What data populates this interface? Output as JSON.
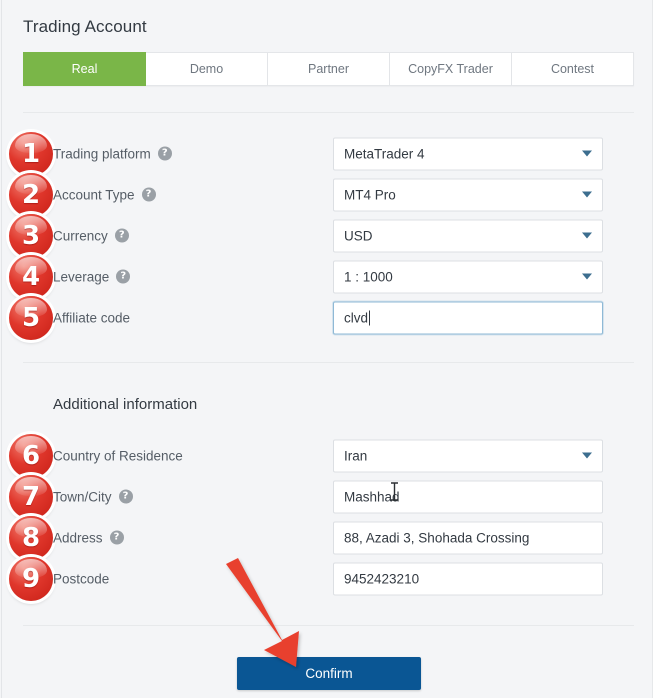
{
  "header": {
    "title": "Trading Account"
  },
  "tabs": [
    {
      "label": "Real",
      "active": true
    },
    {
      "label": "Demo",
      "active": false
    },
    {
      "label": "Partner",
      "active": false
    },
    {
      "label": "CopyFX Trader",
      "active": false
    },
    {
      "label": "Contest",
      "active": false
    }
  ],
  "account_form": {
    "rows": [
      {
        "badge": "1",
        "label": "Trading platform",
        "has_help": true,
        "control_type": "dropdown",
        "value": "MetaTrader 4",
        "focused": false
      },
      {
        "badge": "2",
        "label": "Account Type",
        "has_help": true,
        "control_type": "dropdown",
        "value": "MT4 Pro",
        "focused": false
      },
      {
        "badge": "3",
        "label": "Currency",
        "has_help": true,
        "control_type": "dropdown",
        "value": "USD",
        "focused": false
      },
      {
        "badge": "4",
        "label": "Leverage",
        "has_help": true,
        "control_type": "dropdown",
        "value": "1 : 1000",
        "focused": false
      },
      {
        "badge": "5",
        "label": "Affiliate code",
        "has_help": false,
        "control_type": "text",
        "value": "clvd",
        "focused": true
      }
    ]
  },
  "additional_information": {
    "heading": "Additional information",
    "rows": [
      {
        "badge": "6",
        "label": "Country of Residence",
        "has_help": false,
        "control_type": "dropdown",
        "value": "Iran",
        "focused": false
      },
      {
        "badge": "7",
        "label": "Town/City",
        "has_help": true,
        "control_type": "text",
        "value": "Mashhad",
        "focused": false
      },
      {
        "badge": "8",
        "label": "Address",
        "has_help": true,
        "control_type": "text",
        "value": "88, Azadi 3, Shohada Crossing",
        "focused": false
      },
      {
        "badge": "9",
        "label": "Postcode",
        "has_help": false,
        "control_type": "text",
        "value": "9452423210",
        "focused": false
      }
    ]
  },
  "footer": {
    "confirm_label": "Confirm"
  },
  "icons": {
    "help": "?",
    "dropdown": "chevron-down-icon",
    "annotation_arrow": "red-arrow-icon",
    "text_cursor": "ibeam-cursor-icon"
  },
  "colors": {
    "page_background": "#f4f5f7",
    "active_tab_green": "#7ab648",
    "confirm_blue": "#0a5694",
    "badge_red": "#d62d22",
    "annotation_red": "#e8412f",
    "focus_border": "#8fb9d6",
    "text_primary": "#333a42",
    "text_secondary": "#555d66",
    "border": "#dcdfe3"
  }
}
